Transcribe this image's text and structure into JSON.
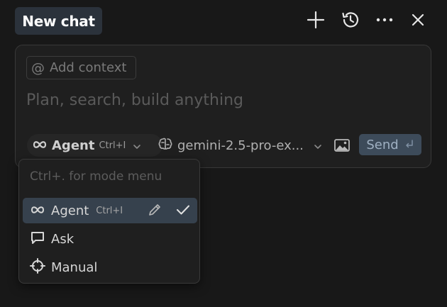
{
  "header": {
    "tab_label": "New chat",
    "icons": [
      "plus-icon",
      "history-icon",
      "more-icon",
      "close-icon"
    ]
  },
  "composer": {
    "context_chip": {
      "label": "Add context",
      "icon": "at-icon"
    },
    "prompt_placeholder": "Plan, search, build anything",
    "mode": {
      "label": "Agent",
      "shortcut": "Ctrl+I"
    },
    "model": {
      "name": "gemini-2.5-pro-ex..."
    },
    "send_label": "Send"
  },
  "mode_menu": {
    "hint": "Ctrl+. for mode menu",
    "items": [
      {
        "label": "Agent",
        "shortcut": "Ctrl+I",
        "icon": "infinity-icon",
        "selected": true
      },
      {
        "label": "Ask",
        "icon": "chat-bubble-icon"
      },
      {
        "label": "Manual",
        "icon": "crosshair-icon"
      }
    ]
  },
  "colors": {
    "background": "#181818",
    "panel": "#1f1f1f",
    "active_item": "#36414d",
    "send_button": "#3d4b5a"
  }
}
